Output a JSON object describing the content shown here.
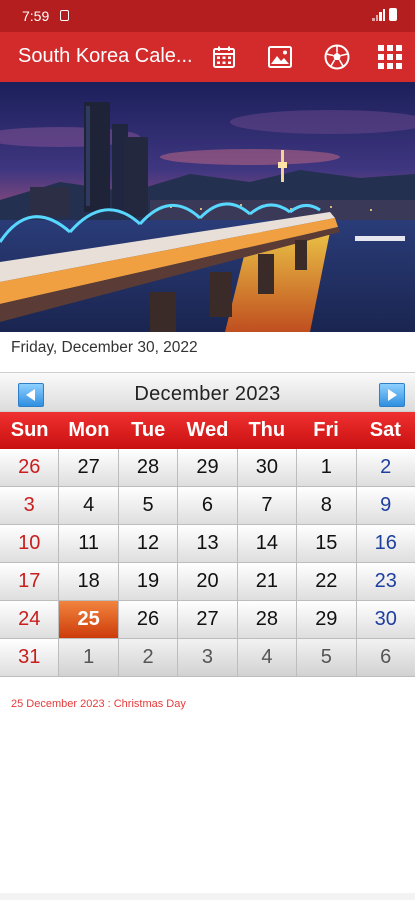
{
  "status": {
    "time": "7:59"
  },
  "app": {
    "title": "South Korea Cale..."
  },
  "current_date": "Friday, December 30, 2022",
  "calendar": {
    "month_title": "December  2023",
    "weekdays": [
      "Sun",
      "Mon",
      "Tue",
      "Wed",
      "Thu",
      "Fri",
      "Sat"
    ],
    "weeks": [
      [
        "26",
        "27",
        "28",
        "29",
        "30",
        "1",
        "2"
      ],
      [
        "3",
        "4",
        "5",
        "6",
        "7",
        "8",
        "9"
      ],
      [
        "10",
        "11",
        "12",
        "13",
        "14",
        "15",
        "16"
      ],
      [
        "17",
        "18",
        "19",
        "20",
        "21",
        "22",
        "23"
      ],
      [
        "24",
        "25",
        "26",
        "27",
        "28",
        "29",
        "30"
      ],
      [
        "31",
        "1",
        "2",
        "3",
        "4",
        "5",
        "6"
      ]
    ],
    "selected_day": "25"
  },
  "holiday_note": "25 December 2023 : Christmas Day",
  "colors": {
    "app_bar": "#d32b2b",
    "status_bar": "#b51e1e",
    "weekday_header": "#e02020",
    "today": "#e0581c",
    "sunday": "#c81e1e",
    "saturday": "#1f3f9f"
  },
  "icons": [
    "calendar-icon",
    "image-icon",
    "soccer-ball-icon",
    "grid-menu-icon",
    "prev-arrow-icon",
    "next-arrow-icon"
  ]
}
